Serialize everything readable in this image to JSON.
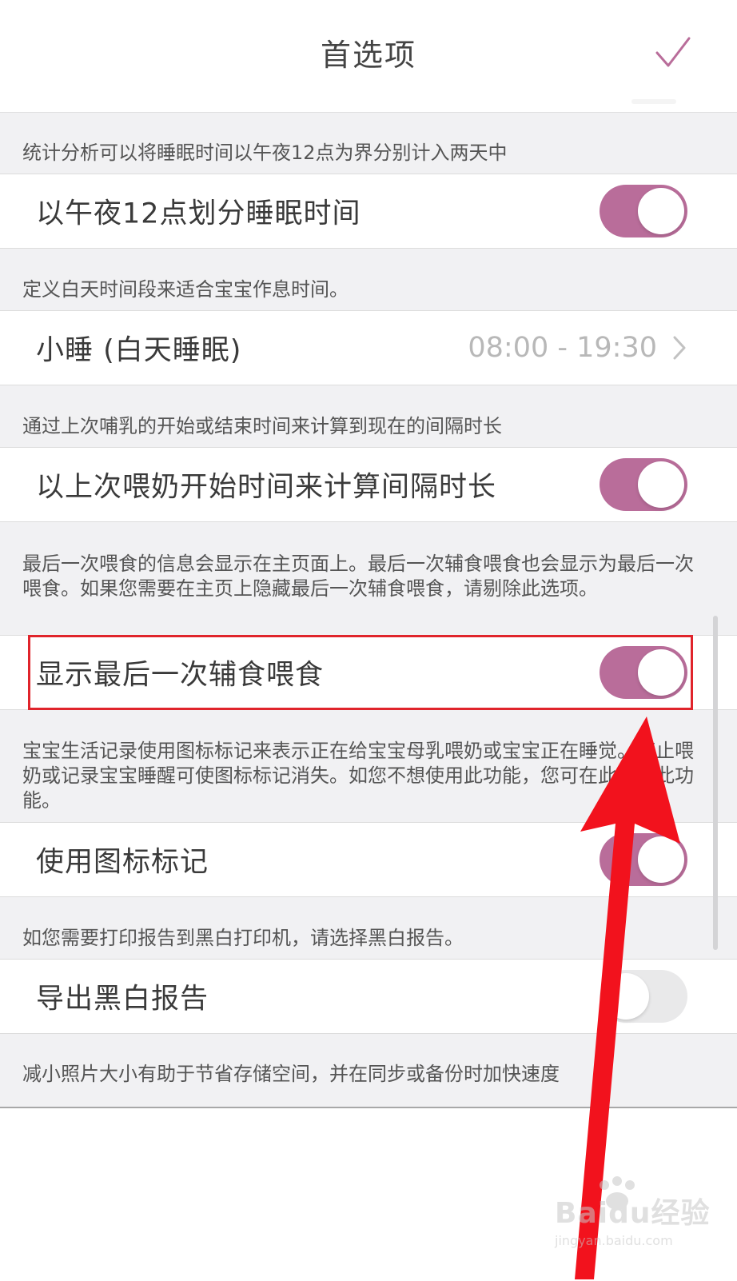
{
  "header": {
    "title": "首选项",
    "done_icon": "checkmark-icon"
  },
  "sections": [
    {
      "description": "统计分析可以将睡眠时间以午夜12点为界分别计入两天中",
      "label": "以午夜12点划分睡眠时间",
      "control": "toggle",
      "on": true
    },
    {
      "description": "定义白天时间段来适合宝宝作息时间。",
      "label": "小睡 (白天睡眠)",
      "control": "disclosure",
      "value": "08:00 - 19:30"
    },
    {
      "description": "通过上次哺乳的开始或结束时间来计算到现在的间隔时长",
      "label": "以上次喂奶开始时间来计算间隔时长",
      "control": "toggle",
      "on": true
    },
    {
      "description": "最后一次喂食的信息会显示在主页面上。最后一次辅食喂食也会显示为最后一次喂食。如果您需要在主页上隐藏最后一次辅食喂食，请剔除此选项。",
      "label": "显示最后一次辅食喂食",
      "control": "toggle",
      "on": true,
      "highlighted": true
    },
    {
      "description": "宝宝生活记录使用图标标记来表示正在给宝宝母乳喂奶或宝宝正在睡觉。停止喂奶或记录宝宝睡醒可使图标标记消失。如您不想使用此功能，您可在此禁用此功能。",
      "label": "使用图标标记",
      "control": "toggle",
      "on": true
    },
    {
      "description": "如您需要打印报告到黑白打印机，请选择黑白报告。",
      "label": "导出黑白报告",
      "control": "toggle",
      "on": false
    }
  ],
  "footer_description": "减小照片大小有助于节省存储空间，并在同步或备份时加快速度",
  "watermark": {
    "logo_text": "Baidu经验",
    "url": "jingyan.baidu.com"
  },
  "colors": {
    "accent": "#b96d9a",
    "highlight": "#e0242b",
    "arrow": "#f2121d",
    "background": "#f1f1f3"
  }
}
